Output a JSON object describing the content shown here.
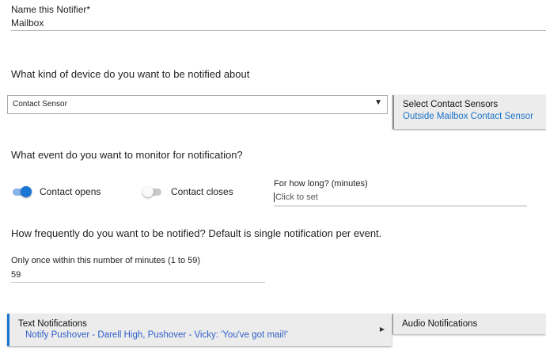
{
  "name_field": {
    "label": "Name this Notifier*",
    "value": "Mailbox"
  },
  "device_question": "What kind of device do you want to be notified about",
  "device_select": {
    "value": "Contact Sensor"
  },
  "sensor_panel": {
    "title": "Select Contact Sensors",
    "value": "Outside Mailbox Contact Sensor"
  },
  "event_question": "What event do you want to monitor for notification?",
  "toggles": [
    {
      "label": "Contact opens",
      "on": true
    },
    {
      "label": "Contact closes",
      "on": false
    }
  ],
  "duration": {
    "label": "For how long? (minutes)",
    "placeholder": "Click to set"
  },
  "frequency_question": "How frequently do you want to be notified?  Default is single notification per event.",
  "frequency_field": {
    "label": "Only once within this number of minutes (1 to 59)",
    "value": "59"
  },
  "text_notifications": {
    "title": "Text Notifications",
    "value": "Notify Pushover - Darell High, Pushover - Vicky: 'You've got mail!'"
  },
  "audio_notifications": {
    "title": "Audio Notifications"
  },
  "colors": {
    "accent": "#1976d2",
    "link": "#1a73c8",
    "link2": "#2f5fc8"
  }
}
